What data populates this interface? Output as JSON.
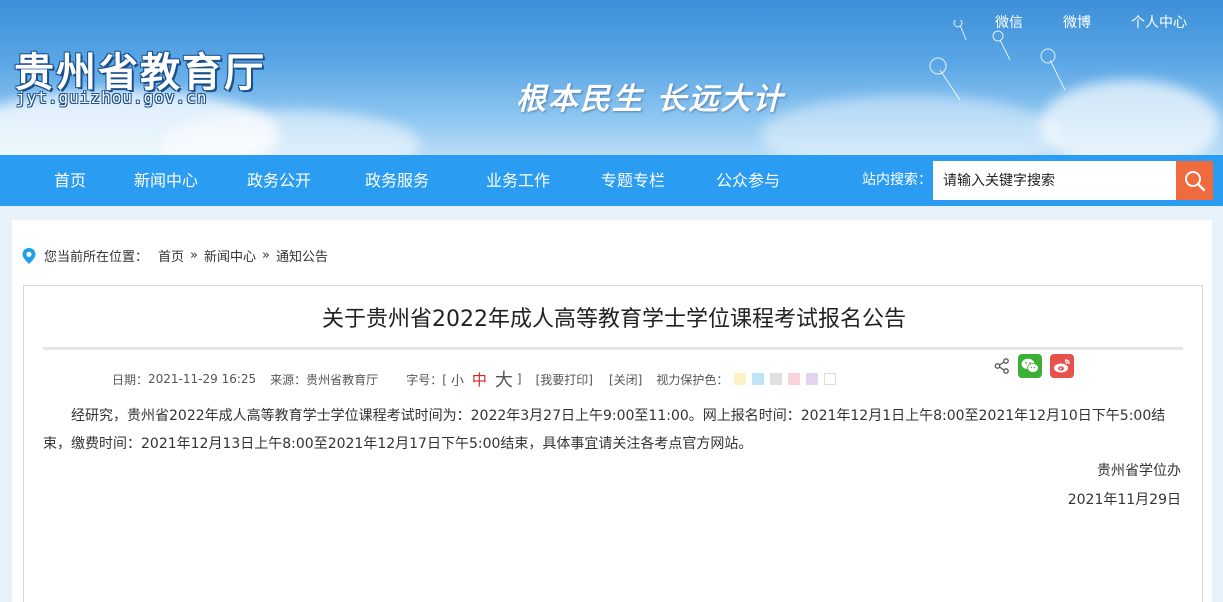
{
  "header": {
    "site_title": "贵州省教育厅",
    "site_domain": "jyt.guizhou.gov.cn",
    "slogan": "根本民生 长远大计",
    "top_links": [
      "微信",
      "微博",
      "个人中心"
    ]
  },
  "nav": {
    "items": [
      "首页",
      "新闻中心",
      "政务公开",
      "政务服务",
      "业务工作",
      "专题专栏",
      "公众参与"
    ],
    "search_label": "站内搜索：",
    "search_placeholder": "请输入关键字搜索"
  },
  "breadcrumb": {
    "prefix": "您当前所在位置：",
    "items": [
      "首页",
      "新闻中心",
      "通知公告"
    ],
    "separator": "»"
  },
  "article": {
    "title": "关于贵州省2022年成人高等教育学士学位课程考试报名公告",
    "date_label": "日期：",
    "date": "2021-11-29 16:25",
    "source_label": "来源：",
    "source": "贵州省教育厅",
    "font_size_label": "字号：[",
    "font_size_close": "]",
    "font_small": "小",
    "font_medium": "中",
    "font_large": "大",
    "print": "[我要打印]",
    "close": "[关闭]",
    "eye_care_label": "视力保护色：",
    "eye_care_colors": [
      "#fbf3c5",
      "#bfe3f7",
      "#e0e0e0",
      "#f8d3d9",
      "#e3d2f2",
      "#ffffff"
    ],
    "body": "经研究，贵州省2022年成人高等教育学士学位课程考试时间为：2022年3月27日上午9:00至11:00。网上报名时间：2021年12月1日上午8:00至2021年12月10日下午5:00结束，缴费时间：2021年12月13日上午8:00至2021年12月17日下午5:00结束，具体事宜请关注各考点官方网站。",
    "signature": "贵州省学位办",
    "signature_date": "2021年11月29日"
  },
  "colors": {
    "nav_bg": "#2a9cf2",
    "search_button": "#f06a3e",
    "wechat_green": "#3cb034",
    "weibo_red": "#e6524c",
    "location_pin": "#1fa0e8"
  },
  "icons": [
    "search-icon",
    "location-pin-icon",
    "share-icon",
    "wechat-icon",
    "weibo-icon"
  ]
}
